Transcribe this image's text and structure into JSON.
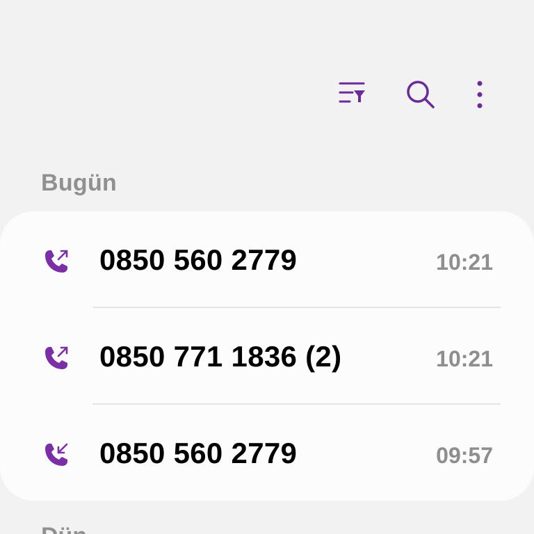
{
  "toolbar": {
    "filter_icon": "filter-list-icon",
    "search_icon": "search-icon",
    "more_icon": "more-vertical-icon"
  },
  "accent_color": "#6a2a9a",
  "sections": [
    {
      "header": "Bugün",
      "calls": [
        {
          "number": "0850 560 2779",
          "time": "10:21",
          "type": "outgoing",
          "icon": "outgoing-call-icon"
        },
        {
          "number": "0850 771 1836 (2)",
          "time": "10:21",
          "type": "outgoing",
          "icon": "outgoing-call-icon"
        },
        {
          "number": "0850 560 2779",
          "time": "09:57",
          "type": "incoming",
          "icon": "incoming-call-icon"
        }
      ]
    },
    {
      "header": "Dün"
    }
  ]
}
